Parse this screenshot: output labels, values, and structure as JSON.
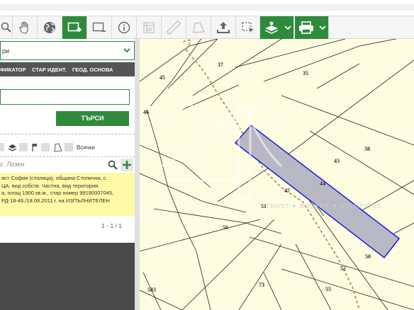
{
  "sidebar": {
    "dropdown_text": "ри",
    "tabs": [
      "ФИКАТОР",
      "СТАР ИДЕНТ.",
      "ГЕОД. ОСНОВА"
    ],
    "search_value": "",
    "search_button": "ТЪРСИ",
    "layers_all": "Всички",
    "results_filter": "с. Лозен",
    "result_lines": [
      "аст София (столица), община Столична, с.",
      "ЦА, вид собств. Частна, вид територия",
      "а, площ 1900 кв.м., стар номер 99190007045,",
      "РД-18-46./18.08.2011 г. на ИЗПЪЛНИТЕЛЕН"
    ],
    "pager": "1 - 1 / 1"
  },
  "map": {
    "parcels": [
      "37",
      "35",
      "45",
      "46",
      "38",
      "43",
      "44",
      "47",
      "51",
      "56",
      "50",
      "52",
      "583",
      "73",
      "55"
    ],
    "watermark": "TRUST ✦ BROKER ✦ SOLUTIONS",
    "colors": {
      "selection_fill": "#b8b8c4",
      "selection_stroke": "#1a1ad6",
      "background": "#fefde1",
      "path": "#b89a78"
    }
  },
  "toolbar": {
    "icons": [
      "zoom-icon",
      "hand-icon",
      "globe-icon",
      "select-area-icon",
      "select-rect-icon",
      "info-icon",
      "measure-grid-icon",
      "ruler-icon",
      "polygon-icon",
      "upload-icon",
      "select-dashed-icon",
      "layers-download-icon",
      "print-icon"
    ]
  }
}
